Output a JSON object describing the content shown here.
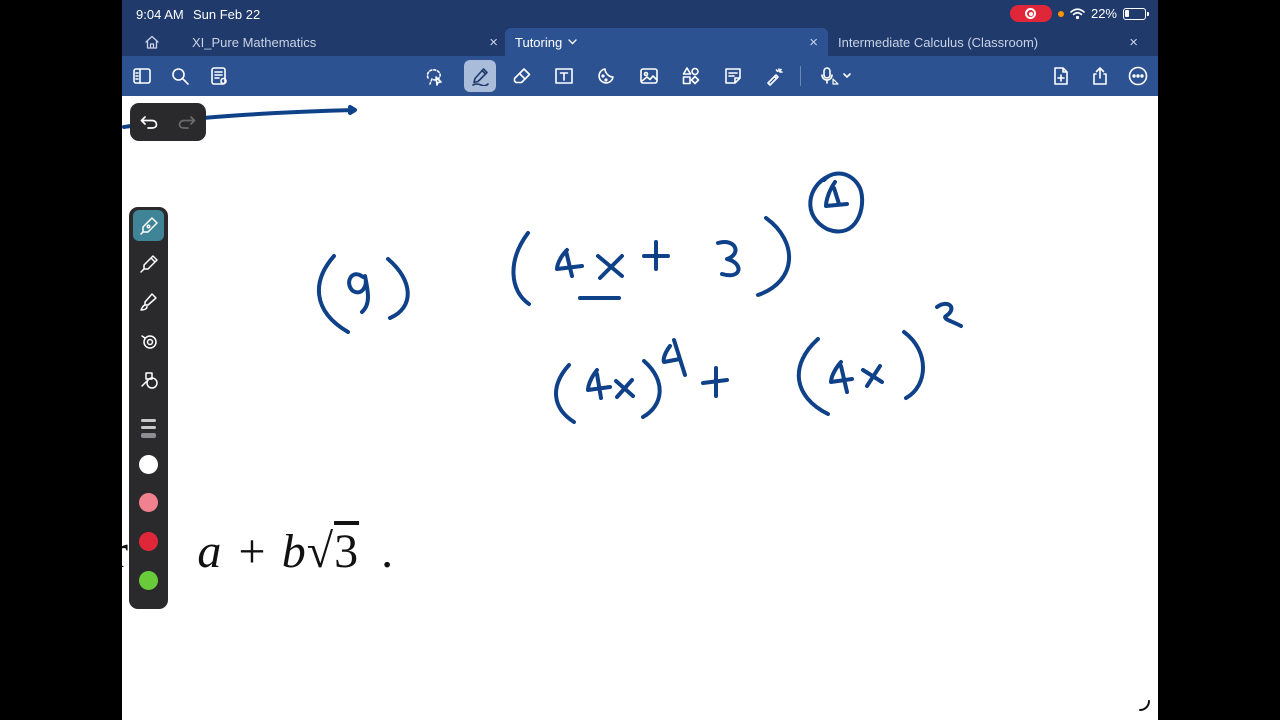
{
  "status": {
    "time": "9:04 AM",
    "date": "Sun Feb 22",
    "battery": "22%",
    "battery_level": 0.22
  },
  "tabs": [
    {
      "label": "XI_Pure Mathematics",
      "close": "×"
    },
    {
      "label": "Tutoring",
      "close": "×",
      "active": true
    },
    {
      "label": "Intermediate Calculus (Classroom)",
      "close": "×"
    }
  ],
  "toolbar": {
    "left": [
      "sidebar-icon",
      "search-icon",
      "page-view-icon"
    ],
    "center": [
      "lasso-icon",
      "pen-icon",
      "eraser-icon",
      "text-box-icon",
      "shapes-sticker-icon",
      "image-icon",
      "elements-icon",
      "sticky-note-icon",
      "laser-pointer-icon",
      "voice-record-icon"
    ],
    "right": [
      "add-page-icon",
      "share-icon",
      "more-icon"
    ],
    "more_glyph": "•••"
  },
  "canvas": {
    "printed_text": {
      "word": "rm",
      "expr_a": "a + b",
      "sqrt_symbol": "√",
      "radicand": "3",
      "period": "."
    }
  },
  "pen_palette": {
    "tools": [
      "fountain-pen-icon",
      "ball-pen-icon",
      "brush-pen-icon",
      "ring-tool-icon",
      "shape-pen-icon"
    ],
    "colors": [
      "#ffffff",
      "#f2818f",
      "#e0273a",
      "#6acb3a"
    ]
  },
  "colors": {
    "accent_dark": "#1f3a6b",
    "accent": "#2c5292",
    "ink": "#0f4188"
  }
}
